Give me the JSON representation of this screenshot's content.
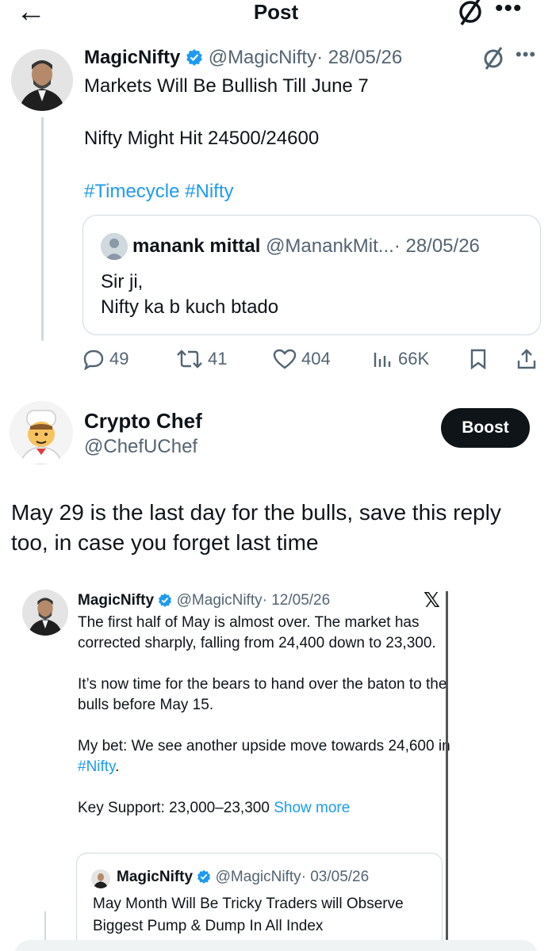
{
  "header": {
    "title": "Post",
    "back_icon": "arrow-left-icon",
    "grok_icon": "grok-icon",
    "more_icon": "more-icon"
  },
  "tweet": {
    "name": "MagicNifty",
    "handle": "@MagicNifty",
    "date": "· 28/05/26",
    "line1": "Markets Will Be Bullish Till June 7",
    "line2": "Nifty Might Hit 24500/24600",
    "hashtags": "#Timecycle #Nifty",
    "quote": {
      "name": "manank mittal",
      "handle": "@ManankMit...",
      "date": "· 28/05/26",
      "line1": "Sir ji,",
      "line2": "Nifty ka b kuch btado"
    },
    "actions": {
      "replies": "49",
      "reposts": "41",
      "likes": "404",
      "views": "66K"
    }
  },
  "reply": {
    "name": "Crypto Chef",
    "handle": "@ChefUChef",
    "boost_label": "Boost",
    "text": "May 29 is the last day for the bulls, save this reply too, in case you forget last time"
  },
  "embedded": {
    "name": "MagicNifty",
    "handle": "@MagicNifty",
    "date": "· 12/05/26",
    "x_logo": "𝕏",
    "p1": "The first half of May is almost over. The market has corrected sharply, falling from 24,400 down to 23,300.",
    "p2": "It’s now time for the bears to hand over the baton to the bulls before May 15.",
    "p3_prefix": "My bet: We see another upside move towards 24,600 in ",
    "p3_hashtag": "#Nifty",
    "p3_suffix": ".",
    "p4_text": "Key Support: 23,000–23,300 ",
    "show_more": "Show more",
    "quote": {
      "name": "MagicNifty",
      "handle": "@MagicNifty",
      "date": "· 03/05/26",
      "text": "May Month Will Be Tricky Traders will Observe Biggest Pump & Dump In All Index"
    }
  },
  "colors": {
    "accent": "#1d9bf0",
    "text": "#0f1419",
    "secondary": "#536471",
    "border": "#cfd9de"
  }
}
